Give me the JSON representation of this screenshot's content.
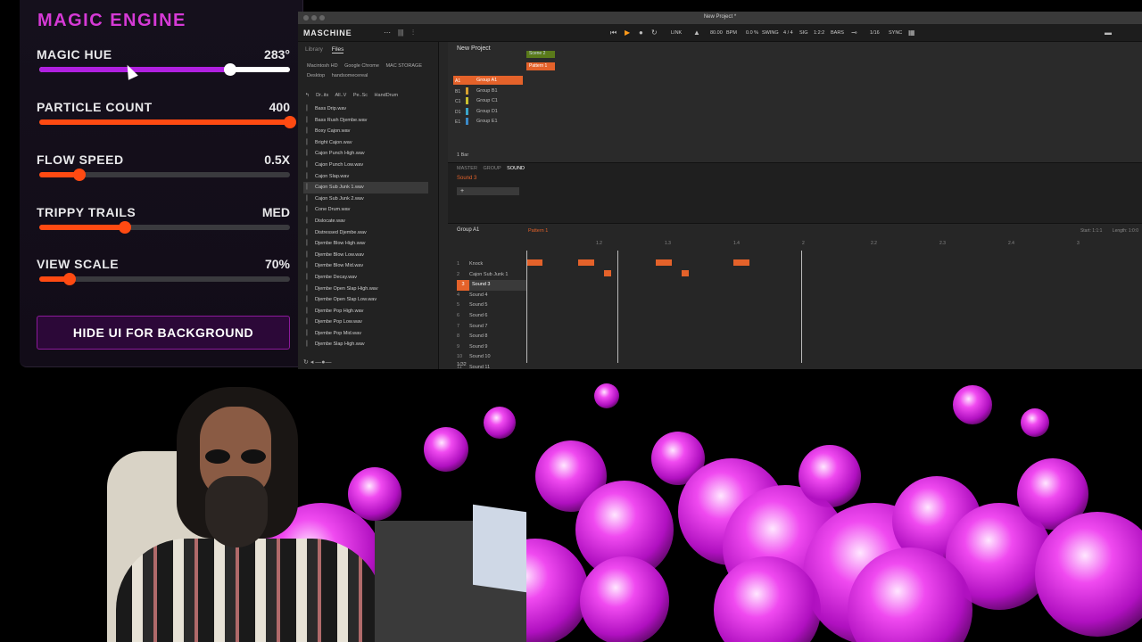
{
  "magic_panel": {
    "title": "MAGIC ENGINE",
    "controls": [
      {
        "label": "MAGIC HUE",
        "value": "283°",
        "level": 0.76,
        "fill": "#b020e0",
        "thumb": "#ffffff"
      },
      {
        "label": "PARTICLE COUNT",
        "value": "400",
        "level": 1.0,
        "fill": "#ff4a12",
        "thumb": "#ff4a12"
      },
      {
        "label": "FLOW SPEED",
        "value": "0.5X",
        "level": 0.16,
        "fill": "#ff4a12",
        "thumb": "#ff4a12"
      },
      {
        "label": "TRIPPY TRAILS",
        "value": "MED",
        "level": 0.34,
        "fill": "#ff4a12",
        "thumb": "#ff4a12"
      },
      {
        "label": "VIEW SCALE",
        "value": "70%",
        "level": 0.12,
        "fill": "#ff4a12",
        "thumb": "#ff4a12"
      }
    ],
    "hide_button": "HIDE UI FOR BACKGROUND"
  },
  "maschine": {
    "window_title": "New Project *",
    "logo": "MASCHINE",
    "toolbar": {
      "tempo": "80.00",
      "bpm": "BPM",
      "swing_value": "0.0 %",
      "swing": "SWING",
      "sig": "4 / 4",
      "sig_label": "SIG",
      "bars": "1:2:2",
      "bars_label": "BARS",
      "quant": "1/16",
      "sync": "SYNC",
      "link": "LINK"
    },
    "browser": {
      "tabs": [
        "Library",
        "Files"
      ],
      "locations": [
        "Macintosh HD",
        "Google Chrome",
        "MAC STORAGE",
        "Desktop",
        "handsomecereal"
      ],
      "crumbs": [
        "Dr..its",
        "All..V",
        "Pe..Sc",
        "HandDrum"
      ],
      "files": [
        "Bass Drip.wav",
        "Bass Rush Djembe.wav",
        "Boxy Cajon.wav",
        "Bright Cajon.wav",
        "Cajon Punch High.wav",
        "Cajon Punch Low.wav",
        "Cajon Slap.wav",
        "Cajon Sub Junk 1.wav",
        "Cajon Sub Junk 2.wav",
        "Cone Drum.wav",
        "Dislocate.wav",
        "Distressed Djembe.wav",
        "Djembe Blow High.wav",
        "Djembe Blow Low.wav",
        "Djembe Blow Mid.wav",
        "Djembe Decay.wav",
        "Djembe Open Slap High.wav",
        "Djembe Open Slap Low.wav",
        "Djembe Pop High.wav",
        "Djembe Pop Low.wav",
        "Djembe Pop Mid.wav",
        "Djembe Slap High.wav"
      ],
      "selected_index": 7
    },
    "arranger": {
      "project": "New Project",
      "groups": [
        {
          "tag": "A1",
          "name": "Group A1",
          "color": "#e4622a"
        },
        {
          "tag": "B1",
          "name": "Group B1",
          "color": "#d7a030"
        },
        {
          "tag": "C1",
          "name": "Group C1",
          "color": "#c9c030"
        },
        {
          "tag": "D1",
          "name": "Group D1",
          "color": "#3aa5c9"
        },
        {
          "tag": "E1",
          "name": "Group E1",
          "color": "#3a8ac9"
        }
      ],
      "scene": "Scene 2",
      "pattern": "Pattern 1",
      "bar_label": "1 Bar"
    },
    "mixer": {
      "tabs": [
        "MASTER",
        "GROUP",
        "SOUND"
      ],
      "sound": "Sound 3",
      "plus": "+"
    },
    "pattern_editor": {
      "group": "Group A1",
      "pattern": "Pattern 1",
      "start": "Start: 1:1:1",
      "length": "Length: 1:0:0",
      "sounds": [
        "Knock",
        "Cajon Sub Junk 1",
        "Sound 3",
        "Sound 4",
        "Sound 5",
        "Sound 6",
        "Sound 7",
        "Sound 8",
        "Sound 9",
        "Sound 10",
        "Sound 11"
      ],
      "selected_sound": 2,
      "ruler": [
        "1.2",
        "1.3",
        "1.4",
        "2",
        "2.2",
        "2.3",
        "2.4",
        "3"
      ],
      "resolution": "1/32"
    }
  }
}
